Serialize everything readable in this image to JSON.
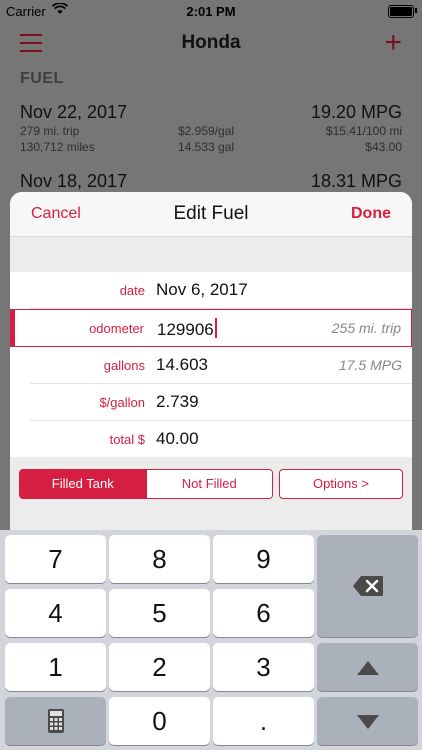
{
  "status_bar": {
    "carrier": "Carrier",
    "time": "2:01 PM"
  },
  "nav": {
    "title": "Honda"
  },
  "list": {
    "section_title": "FUEL",
    "entries": [
      {
        "date": "Nov 22, 2017",
        "mpg": "19.20 MPG",
        "trip": "279 mi. trip",
        "price": "$2.959/gal",
        "cost_per_100": "$15.41/100 mi",
        "miles": "130,712 miles",
        "gallons": "14.533 gal",
        "total": "$43.00"
      },
      {
        "date": "Nov 18, 2017",
        "mpg": "18.31 MPG"
      }
    ]
  },
  "sheet": {
    "cancel_label": "Cancel",
    "title": "Edit Fuel",
    "done_label": "Done",
    "fields": [
      {
        "label": "date",
        "value": "Nov 6, 2017",
        "hint": ""
      },
      {
        "label": "odometer",
        "value": "129906",
        "hint": "255 mi. trip"
      },
      {
        "label": "gallons",
        "value": "14.603",
        "hint": "17.5 MPG"
      },
      {
        "label": "$/gallon",
        "value": "2.739",
        "hint": ""
      },
      {
        "label": "total $",
        "value": "40.00",
        "hint": ""
      }
    ],
    "tank_options": [
      "Filled Tank",
      "Not Filled"
    ],
    "tank_selected": "Filled Tank",
    "options_label": "Options >"
  },
  "keypad": {
    "keys": [
      "7",
      "8",
      "9",
      "4",
      "5",
      "6",
      "1",
      "2",
      "3",
      "0",
      "."
    ]
  },
  "colors": {
    "accent": "#d41e42",
    "accent_dim": "#7a0f1f",
    "keypad_bg": "#d2d5db"
  },
  "icons": [
    "menu-icon",
    "plus-icon",
    "wifi-icon",
    "battery-icon",
    "backspace-icon",
    "calculator-icon",
    "arrow-up-icon",
    "arrow-down-icon"
  ]
}
